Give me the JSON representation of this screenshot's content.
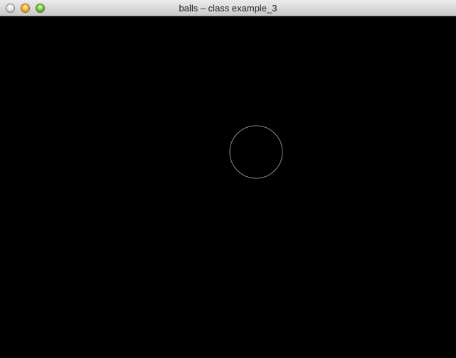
{
  "window": {
    "title": "balls – class example_3"
  },
  "colors": {
    "canvas_background": "#000000",
    "ball_stroke": "#8c8c8c"
  },
  "icons": {
    "close": "close-icon",
    "minimize": "minimize-icon",
    "zoom": "zoom-icon"
  }
}
